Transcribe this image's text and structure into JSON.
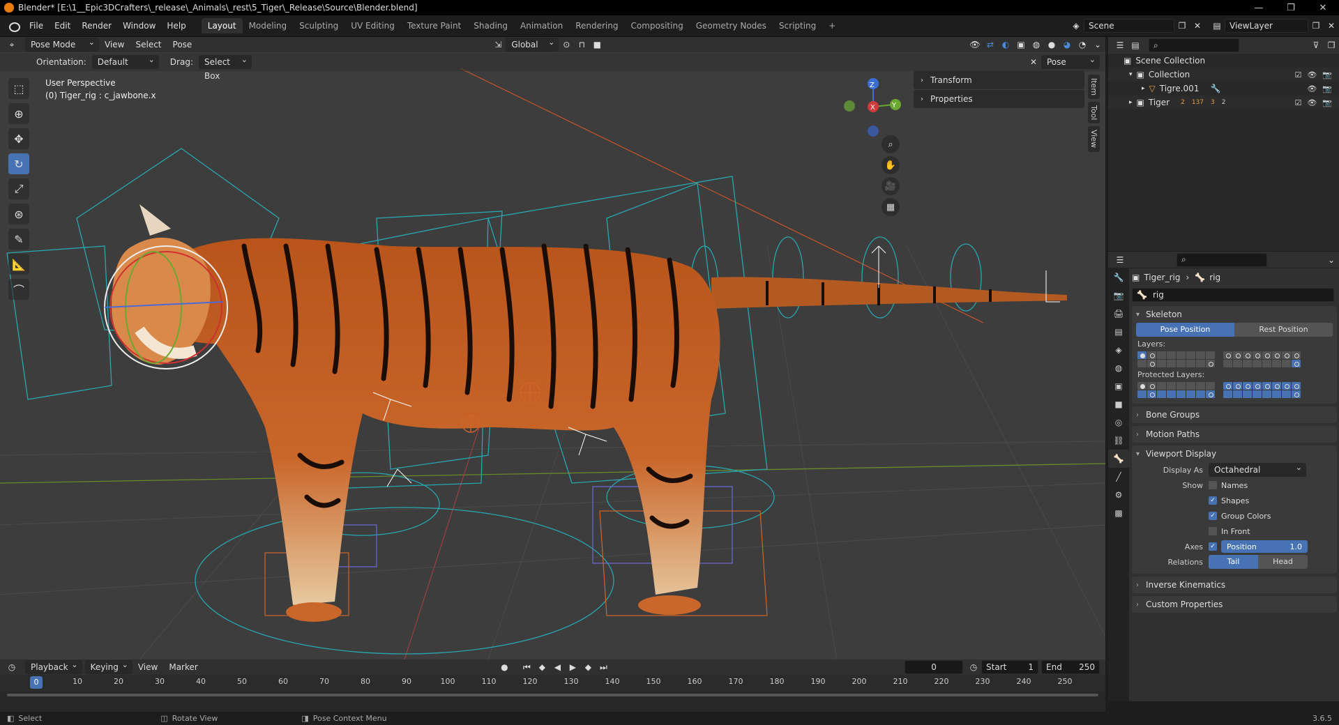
{
  "window_title": "Blender* [E:\\1__Epic3DCrafters\\_release\\_Animals\\_rest\\5_Tiger\\_Release\\Source\\Blender.blend]",
  "menu": [
    "File",
    "Edit",
    "Render",
    "Window",
    "Help"
  ],
  "workspaces": [
    "Layout",
    "Modeling",
    "Sculpting",
    "UV Editing",
    "Texture Paint",
    "Shading",
    "Animation",
    "Rendering",
    "Compositing",
    "Geometry Nodes",
    "Scripting"
  ],
  "active_workspace": "Layout",
  "scene_name": "Scene",
  "view_layer": "ViewLayer",
  "viewport": {
    "mode": "Pose Mode",
    "header_menus": [
      "View",
      "Select",
      "Pose"
    ],
    "transform_orientation": "Global",
    "orientation_label": "Orientation:",
    "orientation_value": "Default",
    "drag_label": "Drag:",
    "drag_value": "Select Box",
    "pose_options": "Pose Options",
    "info_line1": "User Perspective",
    "info_line2": "(0) Tiger_rig : c_jawbone.x",
    "npanel": [
      "Transform",
      "Properties"
    ],
    "side_tabs": [
      "Item",
      "Tool",
      "View"
    ],
    "gizmo": {
      "z": "Z",
      "y": "Y",
      "x": "X"
    }
  },
  "outliner": {
    "rows": [
      {
        "label": "Scene Collection",
        "indent": 0
      },
      {
        "label": "Collection",
        "indent": 1
      },
      {
        "label": "Tigre.001",
        "indent": 2
      },
      {
        "label": "Tiger",
        "indent": 1,
        "counts": [
          "2",
          "137",
          "3",
          "2"
        ]
      }
    ]
  },
  "properties": {
    "breadcrumb_object": "Tiger_rig",
    "breadcrumb_data": "rig",
    "data_name": "rig",
    "skeleton": {
      "title": "Skeleton",
      "pose_position": "Pose Position",
      "rest_position": "Rest Position",
      "layers_label": "Layers:",
      "protected_label": "Protected Layers:"
    },
    "collapsed": [
      "Bone Groups",
      "Motion Paths"
    ],
    "viewport_display": {
      "title": "Viewport Display",
      "display_as_label": "Display As",
      "display_as_value": "Octahedral",
      "show_label": "Show",
      "names": "Names",
      "shapes": "Shapes",
      "group_colors": "Group Colors",
      "in_front": "In Front",
      "axes_label": "Axes",
      "axes_position": "Position",
      "axes_value": "1.0",
      "relations_label": "Relations",
      "tail": "Tail",
      "head": "Head"
    },
    "collapsed_bottom": [
      "Inverse Kinematics",
      "Custom Properties"
    ]
  },
  "timeline": {
    "menus": [
      "Playback",
      "Keying",
      "View",
      "Marker"
    ],
    "current_frame": "0",
    "start_label": "Start",
    "start": "1",
    "end_label": "End",
    "end": "250",
    "ticks": [
      "0",
      "10",
      "20",
      "30",
      "40",
      "50",
      "60",
      "70",
      "80",
      "90",
      "100",
      "110",
      "120",
      "130",
      "140",
      "150",
      "160",
      "170",
      "180",
      "190",
      "200",
      "210",
      "220",
      "230",
      "240",
      "250"
    ]
  },
  "statusbar": {
    "left": "Select",
    "middle": "Rotate View",
    "right": "Pose Context Menu",
    "version": "3.6.5"
  }
}
